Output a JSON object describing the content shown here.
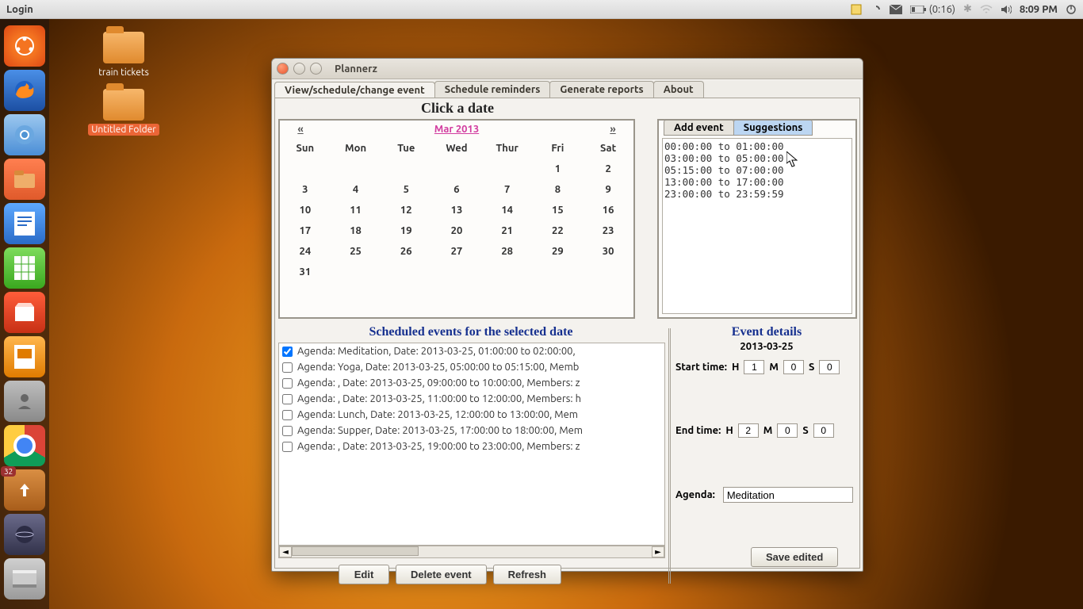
{
  "menubar": {
    "left": "Login",
    "battery": "(0:16)",
    "time": "8:09 PM"
  },
  "desktop": {
    "icon1": "train tickets",
    "icon2": "Untitled Folder"
  },
  "window": {
    "title": "Plannerz",
    "tabs": {
      "t0": "View/schedule/change event",
      "t1": "Schedule reminders",
      "t2": "Generate reports",
      "t3": "About"
    }
  },
  "calendar": {
    "heading": "Click a date",
    "prev": "«",
    "next": "»",
    "month": "Mar 2013",
    "dow": {
      "d0": "Sun",
      "d1": "Mon",
      "d2": "Tue",
      "d3": "Wed",
      "d4": "Thur",
      "d5": "Fri",
      "d6": "Sat"
    },
    "cells": {
      "r0": {
        "c0": "",
        "c1": "",
        "c2": "",
        "c3": "",
        "c4": "",
        "c5": "1",
        "c6": "2"
      },
      "r1": {
        "c0": "3",
        "c1": "4",
        "c2": "5",
        "c3": "6",
        "c4": "7",
        "c5": "8",
        "c6": "9"
      },
      "r2": {
        "c0": "10",
        "c1": "11",
        "c2": "12",
        "c3": "13",
        "c4": "14",
        "c5": "15",
        "c6": "16"
      },
      "r3": {
        "c0": "17",
        "c1": "18",
        "c2": "19",
        "c3": "20",
        "c4": "21",
        "c5": "22",
        "c6": "23"
      },
      "r4": {
        "c0": "24",
        "c1": "25",
        "c2": "26",
        "c3": "27",
        "c4": "28",
        "c5": "29",
        "c6": "30"
      },
      "r5": {
        "c0": "31",
        "c1": "",
        "c2": "",
        "c3": "",
        "c4": "",
        "c5": "",
        "c6": ""
      }
    }
  },
  "suggestions": {
    "tabs": {
      "add": "Add event",
      "sug": "Suggestions"
    },
    "lines": {
      "l0": "00:00:00 to 01:00:00",
      "l1": "03:00:00 to 05:00:00",
      "l2": "05:15:00 to 07:00:00",
      "l3": "13:00:00 to 17:00:00",
      "l4": "23:00:00 to 23:59:59"
    }
  },
  "scheduled": {
    "heading": "Scheduled events for the selected date",
    "rows": {
      "r0": "Agenda: Meditation, Date: 2013-03-25, 01:00:00 to 02:00:00, ",
      "r1": "Agenda: Yoga, Date: 2013-03-25, 05:00:00 to 05:15:00, Memb",
      "r2": "Agenda: , Date: 2013-03-25, 09:00:00 to 10:00:00, Members: z",
      "r3": "Agenda: , Date: 2013-03-25, 11:00:00 to 12:00:00, Members: h",
      "r4": "Agenda: Lunch, Date: 2013-03-25, 12:00:00 to 13:00:00, Mem",
      "r5": "Agenda: Supper, Date: 2013-03-25, 17:00:00 to 18:00:00, Mem",
      "r6": "Agenda: , Date: 2013-03-25, 19:00:00 to 23:00:00, Members: z"
    },
    "buttons": {
      "edit": "Edit",
      "del": "Delete event",
      "ref": "Refresh"
    }
  },
  "details": {
    "heading": "Event details",
    "date": "2013-03-25",
    "start_label": "Start time:",
    "end_label": "End time:",
    "H": "H",
    "M": "M",
    "S": "S",
    "agenda_label": "Agenda:",
    "start": {
      "h": "1",
      "m": "0",
      "s": "0"
    },
    "end": {
      "h": "2",
      "m": "0",
      "s": "0"
    },
    "agenda": "Meditation",
    "save": "Save edited"
  },
  "launcher_badge": "32"
}
